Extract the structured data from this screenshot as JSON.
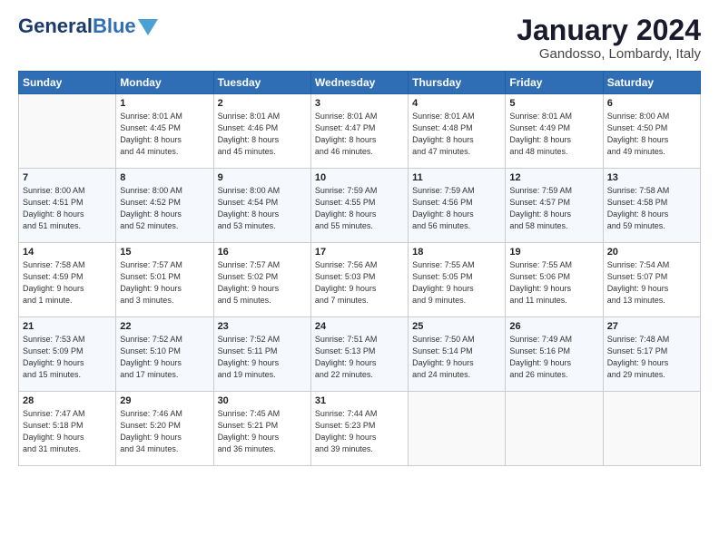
{
  "header": {
    "logo_general": "General",
    "logo_blue": "Blue",
    "month_title": "January 2024",
    "location": "Gandosso, Lombardy, Italy"
  },
  "calendar": {
    "weekdays": [
      "Sunday",
      "Monday",
      "Tuesday",
      "Wednesday",
      "Thursday",
      "Friday",
      "Saturday"
    ],
    "weeks": [
      [
        {
          "day": "",
          "info": ""
        },
        {
          "day": "1",
          "info": "Sunrise: 8:01 AM\nSunset: 4:45 PM\nDaylight: 8 hours\nand 44 minutes."
        },
        {
          "day": "2",
          "info": "Sunrise: 8:01 AM\nSunset: 4:46 PM\nDaylight: 8 hours\nand 45 minutes."
        },
        {
          "day": "3",
          "info": "Sunrise: 8:01 AM\nSunset: 4:47 PM\nDaylight: 8 hours\nand 46 minutes."
        },
        {
          "day": "4",
          "info": "Sunrise: 8:01 AM\nSunset: 4:48 PM\nDaylight: 8 hours\nand 47 minutes."
        },
        {
          "day": "5",
          "info": "Sunrise: 8:01 AM\nSunset: 4:49 PM\nDaylight: 8 hours\nand 48 minutes."
        },
        {
          "day": "6",
          "info": "Sunrise: 8:00 AM\nSunset: 4:50 PM\nDaylight: 8 hours\nand 49 minutes."
        }
      ],
      [
        {
          "day": "7",
          "info": "Sunrise: 8:00 AM\nSunset: 4:51 PM\nDaylight: 8 hours\nand 51 minutes."
        },
        {
          "day": "8",
          "info": "Sunrise: 8:00 AM\nSunset: 4:52 PM\nDaylight: 8 hours\nand 52 minutes."
        },
        {
          "day": "9",
          "info": "Sunrise: 8:00 AM\nSunset: 4:54 PM\nDaylight: 8 hours\nand 53 minutes."
        },
        {
          "day": "10",
          "info": "Sunrise: 7:59 AM\nSunset: 4:55 PM\nDaylight: 8 hours\nand 55 minutes."
        },
        {
          "day": "11",
          "info": "Sunrise: 7:59 AM\nSunset: 4:56 PM\nDaylight: 8 hours\nand 56 minutes."
        },
        {
          "day": "12",
          "info": "Sunrise: 7:59 AM\nSunset: 4:57 PM\nDaylight: 8 hours\nand 58 minutes."
        },
        {
          "day": "13",
          "info": "Sunrise: 7:58 AM\nSunset: 4:58 PM\nDaylight: 8 hours\nand 59 minutes."
        }
      ],
      [
        {
          "day": "14",
          "info": "Sunrise: 7:58 AM\nSunset: 4:59 PM\nDaylight: 9 hours\nand 1 minute."
        },
        {
          "day": "15",
          "info": "Sunrise: 7:57 AM\nSunset: 5:01 PM\nDaylight: 9 hours\nand 3 minutes."
        },
        {
          "day": "16",
          "info": "Sunrise: 7:57 AM\nSunset: 5:02 PM\nDaylight: 9 hours\nand 5 minutes."
        },
        {
          "day": "17",
          "info": "Sunrise: 7:56 AM\nSunset: 5:03 PM\nDaylight: 9 hours\nand 7 minutes."
        },
        {
          "day": "18",
          "info": "Sunrise: 7:55 AM\nSunset: 5:05 PM\nDaylight: 9 hours\nand 9 minutes."
        },
        {
          "day": "19",
          "info": "Sunrise: 7:55 AM\nSunset: 5:06 PM\nDaylight: 9 hours\nand 11 minutes."
        },
        {
          "day": "20",
          "info": "Sunrise: 7:54 AM\nSunset: 5:07 PM\nDaylight: 9 hours\nand 13 minutes."
        }
      ],
      [
        {
          "day": "21",
          "info": "Sunrise: 7:53 AM\nSunset: 5:09 PM\nDaylight: 9 hours\nand 15 minutes."
        },
        {
          "day": "22",
          "info": "Sunrise: 7:52 AM\nSunset: 5:10 PM\nDaylight: 9 hours\nand 17 minutes."
        },
        {
          "day": "23",
          "info": "Sunrise: 7:52 AM\nSunset: 5:11 PM\nDaylight: 9 hours\nand 19 minutes."
        },
        {
          "day": "24",
          "info": "Sunrise: 7:51 AM\nSunset: 5:13 PM\nDaylight: 9 hours\nand 22 minutes."
        },
        {
          "day": "25",
          "info": "Sunrise: 7:50 AM\nSunset: 5:14 PM\nDaylight: 9 hours\nand 24 minutes."
        },
        {
          "day": "26",
          "info": "Sunrise: 7:49 AM\nSunset: 5:16 PM\nDaylight: 9 hours\nand 26 minutes."
        },
        {
          "day": "27",
          "info": "Sunrise: 7:48 AM\nSunset: 5:17 PM\nDaylight: 9 hours\nand 29 minutes."
        }
      ],
      [
        {
          "day": "28",
          "info": "Sunrise: 7:47 AM\nSunset: 5:18 PM\nDaylight: 9 hours\nand 31 minutes."
        },
        {
          "day": "29",
          "info": "Sunrise: 7:46 AM\nSunset: 5:20 PM\nDaylight: 9 hours\nand 34 minutes."
        },
        {
          "day": "30",
          "info": "Sunrise: 7:45 AM\nSunset: 5:21 PM\nDaylight: 9 hours\nand 36 minutes."
        },
        {
          "day": "31",
          "info": "Sunrise: 7:44 AM\nSunset: 5:23 PM\nDaylight: 9 hours\nand 39 minutes."
        },
        {
          "day": "",
          "info": ""
        },
        {
          "day": "",
          "info": ""
        },
        {
          "day": "",
          "info": ""
        }
      ]
    ]
  }
}
